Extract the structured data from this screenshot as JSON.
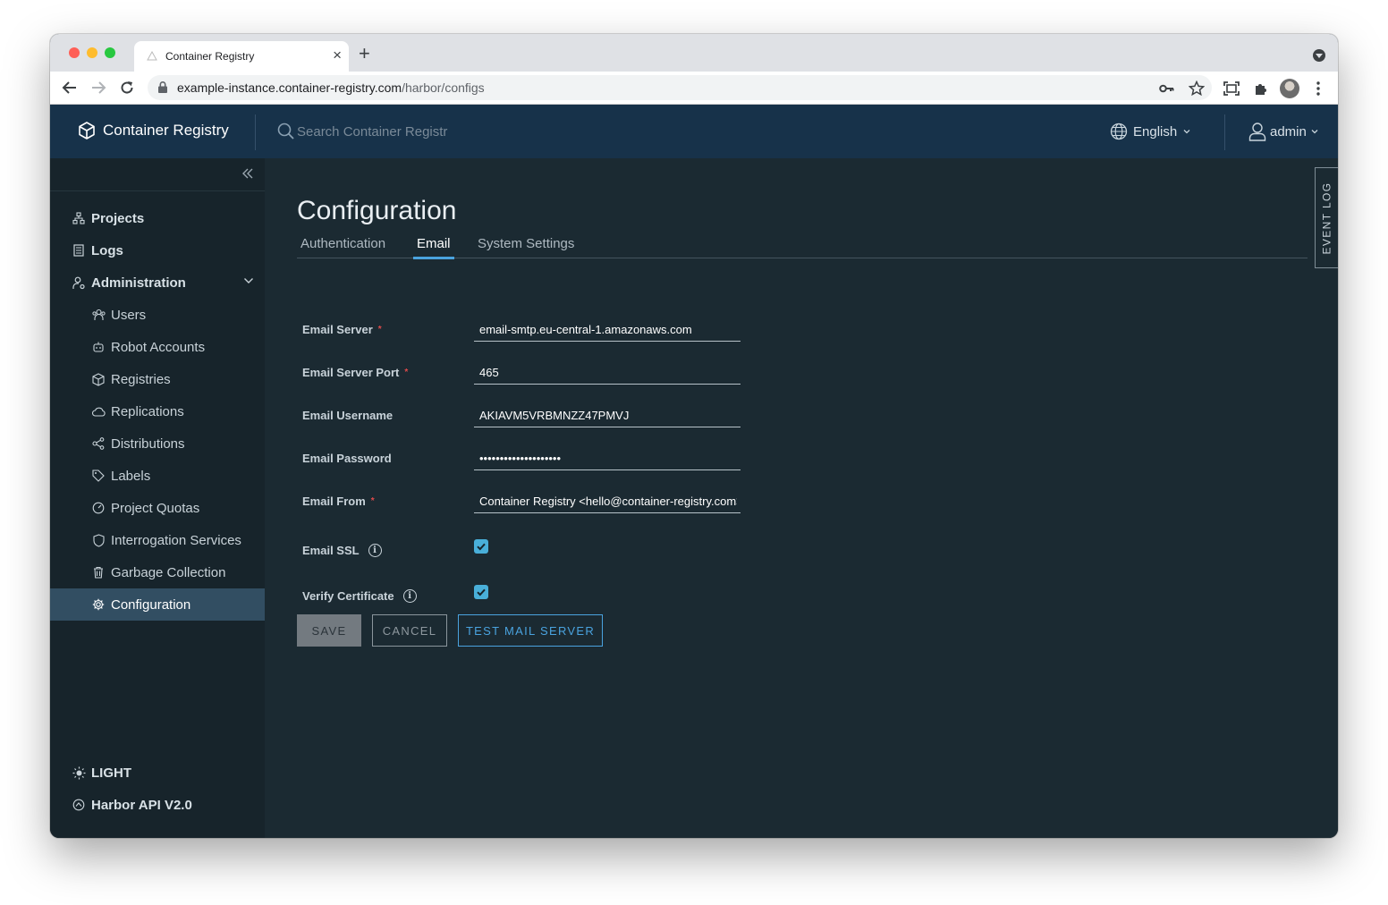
{
  "browser": {
    "tab_title": "Container Registry",
    "url_host": "example-instance.container-registry.com",
    "url_path": "/harbor/configs"
  },
  "header": {
    "app_name": "Container Registry",
    "search_placeholder": "Search Container Registr",
    "language": "English",
    "user": "admin"
  },
  "sidebar": {
    "items": [
      {
        "label": "Projects",
        "icon": "projects-icon"
      },
      {
        "label": "Logs",
        "icon": "logs-icon"
      },
      {
        "label": "Administration",
        "icon": "administration-icon",
        "expanded": true
      }
    ],
    "admin_items": [
      {
        "label": "Users",
        "icon": "users-icon"
      },
      {
        "label": "Robot Accounts",
        "icon": "robot-icon"
      },
      {
        "label": "Registries",
        "icon": "registries-icon"
      },
      {
        "label": "Replications",
        "icon": "replications-icon"
      },
      {
        "label": "Distributions",
        "icon": "distributions-icon"
      },
      {
        "label": "Labels",
        "icon": "labels-icon"
      },
      {
        "label": "Project Quotas",
        "icon": "quotas-icon"
      },
      {
        "label": "Interrogation Services",
        "icon": "shield-icon"
      },
      {
        "label": "Garbage Collection",
        "icon": "trash-icon"
      },
      {
        "label": "Configuration",
        "icon": "gear-icon",
        "active": true
      }
    ],
    "footer": {
      "theme": "LIGHT",
      "api": "Harbor API V2.0"
    }
  },
  "main": {
    "title": "Configuration",
    "tabs": [
      {
        "label": "Authentication"
      },
      {
        "label": "Email",
        "active": true
      },
      {
        "label": "System Settings"
      }
    ],
    "fields": [
      {
        "label": "Email Server",
        "required": true,
        "value": "email-smtp.eu-central-1.amazonaws.com"
      },
      {
        "label": "Email Server Port",
        "required": true,
        "value": "465"
      },
      {
        "label": "Email Username",
        "required": false,
        "value": "AKIAVM5VRBMNZZ47PMVJ"
      },
      {
        "label": "Email Password",
        "required": false,
        "value": "••••••••••••••••••••"
      },
      {
        "label": "Email From",
        "required": true,
        "value": "Container Registry <hello@container-registry.com>"
      }
    ],
    "email_ssl": {
      "label": "Email SSL",
      "checked": true
    },
    "verify_cert": {
      "label": "Verify Certificate",
      "checked": true
    },
    "buttons": {
      "save": "SAVE",
      "cancel": "CANCEL",
      "test": "TEST MAIL SERVER"
    },
    "event_log": "EVENT LOG"
  },
  "colors": {
    "header_bg": "#17324a",
    "sidebar_bg": "#17242b",
    "main_bg": "#1b2a32",
    "accent": "#4aa3df",
    "active_nav": "#324e62",
    "required": "#e04b4b"
  }
}
